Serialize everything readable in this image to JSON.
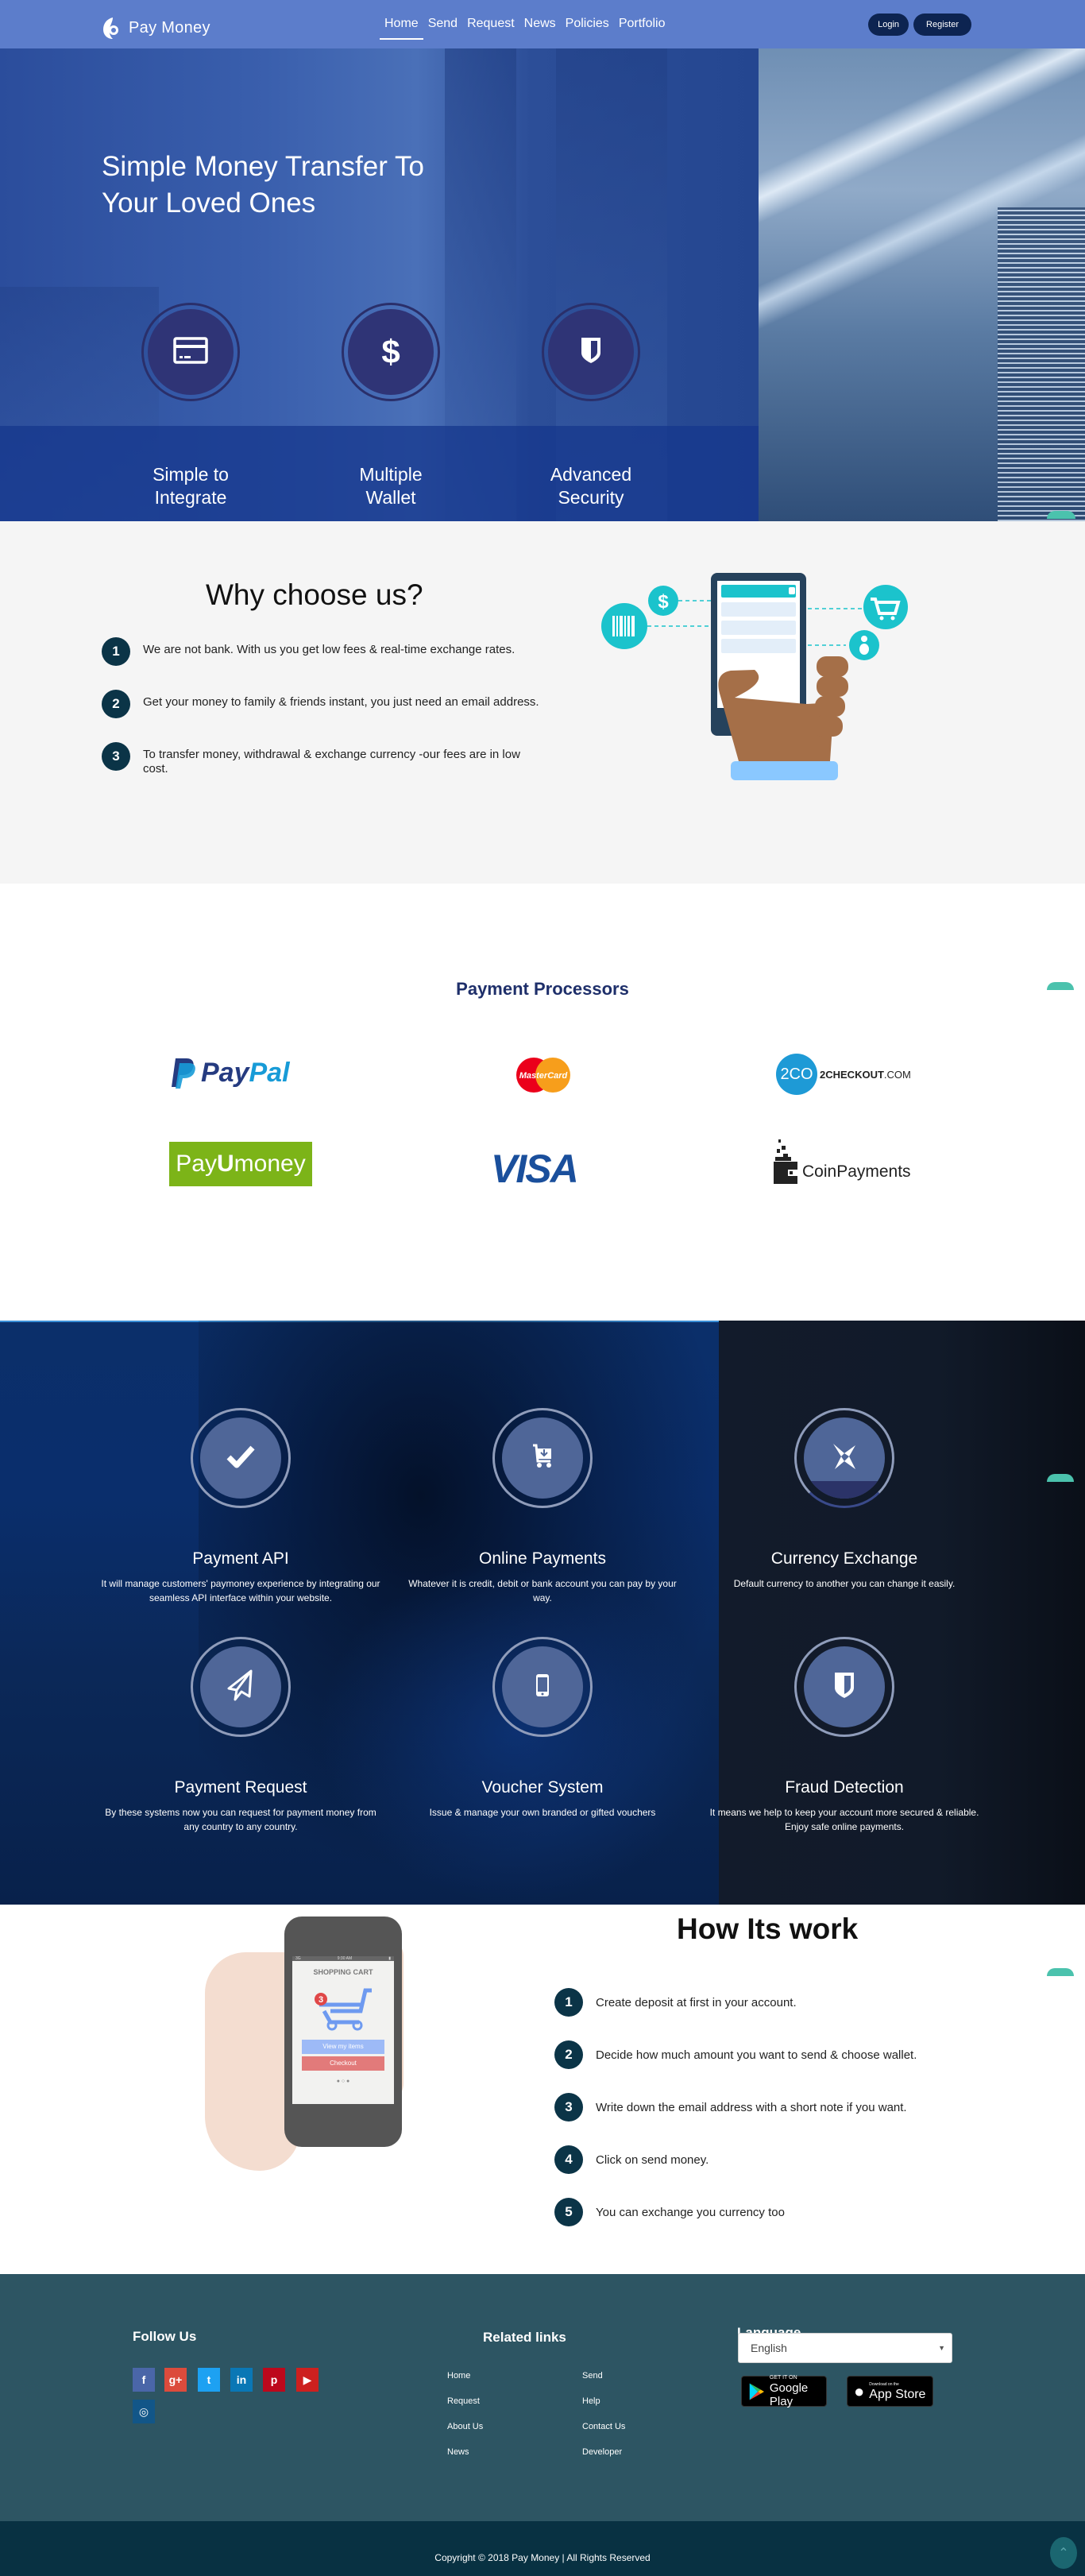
{
  "nav": {
    "brand": "Pay Money",
    "menu": [
      {
        "label": "Home",
        "active": true
      },
      {
        "label": "Send"
      },
      {
        "label": "Request"
      },
      {
        "label": "News"
      },
      {
        "label": "Policies"
      },
      {
        "label": "Portfolio"
      }
    ],
    "login": "Login",
    "register": "Register"
  },
  "hero": {
    "title_line1": "Simple Money Transfer To",
    "title_line2": "Your Loved Ones",
    "features": [
      {
        "icon": "credit-card-icon",
        "line1": "Simple to",
        "line2": "Integrate"
      },
      {
        "icon": "dollar-icon",
        "line1": "Multiple",
        "line2": "Wallet"
      },
      {
        "icon": "shield-icon",
        "line1": "Advanced",
        "line2": "Security"
      }
    ]
  },
  "why": {
    "title": "Why choose us?",
    "items": [
      {
        "num": "1",
        "text": "We are not bank. With us you get low fees & real-time exchange rates."
      },
      {
        "num": "2",
        "text": "Get your money to family & friends instant, you just need an email address."
      },
      {
        "num": "3",
        "text": "To transfer money, withdrawal & exchange currency -our fees are in low cost."
      }
    ]
  },
  "processors": {
    "title": "Payment Processors",
    "logos": [
      {
        "name": "PayPal",
        "pay": "Pay",
        "pal": "Pal"
      },
      {
        "name": "MasterCard"
      },
      {
        "name": "2CHECKOUT.COM",
        "badge": "2CO",
        "bold": "2CHECKOUT",
        "suffix": ".COM"
      },
      {
        "name": "PayUmoney",
        "pay": "Pay",
        "u": "U",
        "money": "money"
      },
      {
        "name": "VISA"
      },
      {
        "name": "CoinPayments"
      }
    ]
  },
  "features": [
    {
      "icon": "checkmark-icon",
      "title": "Payment API",
      "desc": "It will manage customers' paymoney experience by integrating our seamless API interface within your website."
    },
    {
      "icon": "cart-download-icon",
      "title": "Online Payments",
      "desc": "Whatever it is credit, debit or bank account you can pay by your way."
    },
    {
      "icon": "exchange-icon",
      "title": "Currency Exchange",
      "desc": "Default currency to another you can change it easily."
    },
    {
      "icon": "paper-plane-icon",
      "title": "Payment Request",
      "desc": "By these systems now you can request for payment money from any country to any country."
    },
    {
      "icon": "mobile-phone-icon",
      "title": "Voucher System",
      "desc": "Issue & manage your own branded or gifted vouchers"
    },
    {
      "icon": "shield-icon",
      "title": "Fraud Detection",
      "desc": "It means we help to keep your account more secured & reliable. Enjoy safe online payments."
    }
  ],
  "how": {
    "title": "How Its work",
    "phone": {
      "status_left": "3G",
      "status_time": "9:30 AM",
      "screen_title": "SHOPPING CART",
      "badge": "3",
      "view_btn": "View my items",
      "checkout_btn": "Checkout"
    },
    "steps": [
      {
        "num": "1",
        "text": "Create deposit at first in your account."
      },
      {
        "num": "2",
        "text": "Decide how much amount you want to send & choose wallet."
      },
      {
        "num": "3",
        "text": "Write down the email address with a short note if you want."
      },
      {
        "num": "4",
        "text": "Click on send money."
      },
      {
        "num": "5",
        "text": "You can exchange you currency too"
      }
    ]
  },
  "footer": {
    "follow_title": "Follow Us",
    "social": [
      {
        "name": "facebook",
        "glyph": "f",
        "color": "#4a66a8"
      },
      {
        "name": "google-plus",
        "glyph": "g+",
        "color": "#dc4b3c"
      },
      {
        "name": "twitter",
        "glyph": "t",
        "color": "#1da1f2"
      },
      {
        "name": "linkedin",
        "glyph": "in",
        "color": "#0a77b5"
      },
      {
        "name": "pinterest",
        "glyph": "p",
        "color": "#bd081c"
      },
      {
        "name": "youtube",
        "glyph": "▶",
        "color": "#cd201f"
      },
      {
        "name": "instagram",
        "glyph": "◎",
        "color": "#125688"
      }
    ],
    "related_title": "Related links",
    "links_col1": [
      "Home",
      "Request",
      "About Us",
      "News"
    ],
    "links_col2": [
      "Send",
      "Help",
      "Contact Us",
      "Developer"
    ],
    "language_title": "Language",
    "language_value": "English",
    "google_play_small": "GET IT ON",
    "google_play_big": "Google Play",
    "app_store_small": "Download on the",
    "app_store_big": "App Store",
    "copyright": "Copyright © 2018   Pay Money | All Rights Reserved"
  },
  "colors": {
    "nav": "#5c7dcb",
    "button_dark": "#0d2451",
    "step_circle": "#0b3447",
    "footer": "#2d5563",
    "footer_bottom": "#083142",
    "accent_teal": "#4bc2ad"
  }
}
